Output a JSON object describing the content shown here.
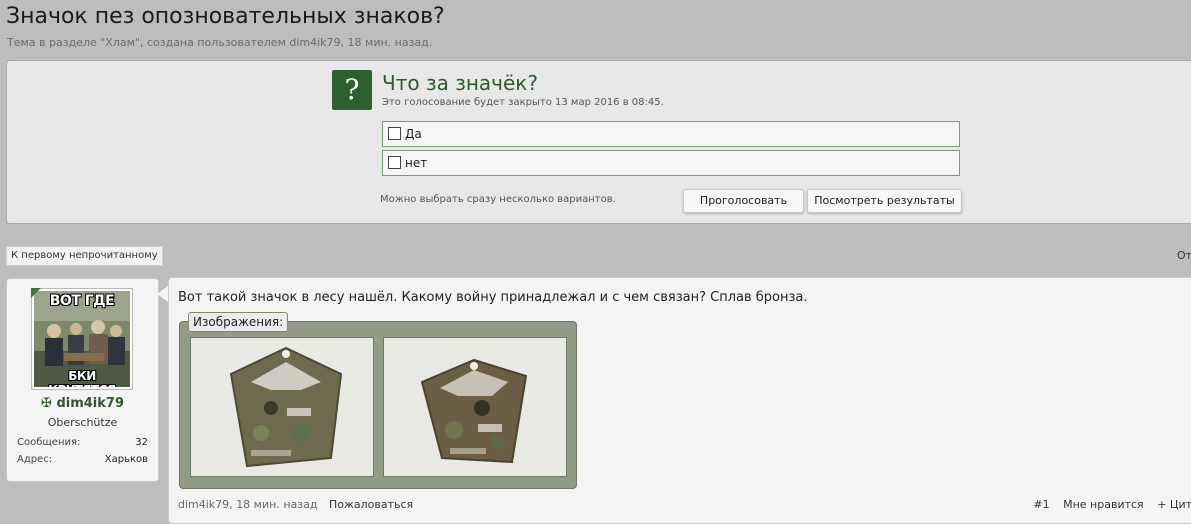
{
  "thread": {
    "title": "Значок пез опозновательных знаков?",
    "subtitle": "Тема в разделе \"Хлам\", создана пользователем dim4ik79, 18 мин. назад."
  },
  "poll": {
    "badge": "?",
    "question": "Что за значёк?",
    "close_info": "Это голосование будет закрыто 13 мар 2016 в 08:45.",
    "options": [
      "Да",
      "нет"
    ],
    "note": "Можно выбрать сразу несколько вариантов.",
    "vote_button": "Проголосовать",
    "results_button": "Посмотреть результаты"
  },
  "nav": {
    "first_unread": "К первому непрочитанному",
    "right_cut": "От"
  },
  "user": {
    "avatar_text_top": "ВОТ ГДЕ",
    "avatar_text_bottom": "БКИ КРУТЯТСЯ",
    "rank_icon": "✠",
    "name": "dim4ik79",
    "title": "Oberschütze",
    "stats": [
      {
        "label": "Сообщения:",
        "value": "32"
      },
      {
        "label": "Адрес:",
        "value": "Харьков"
      }
    ]
  },
  "post": {
    "message": "Вот такой значок в лесу нашёл. Какому войну принадлежал и с чем связан? Сплав бронза.",
    "attachments_label": "Изображения:",
    "author": "dim4ik79",
    "time": "18 мин. назад",
    "report": "Пожаловаться",
    "number": "#1",
    "like": "Мне нравится",
    "quote": "+ Цит"
  },
  "colors": {
    "page_bg": "#bdbdbd",
    "accent_green": "#2e5f2e",
    "attachment_frame": "#919b87"
  }
}
